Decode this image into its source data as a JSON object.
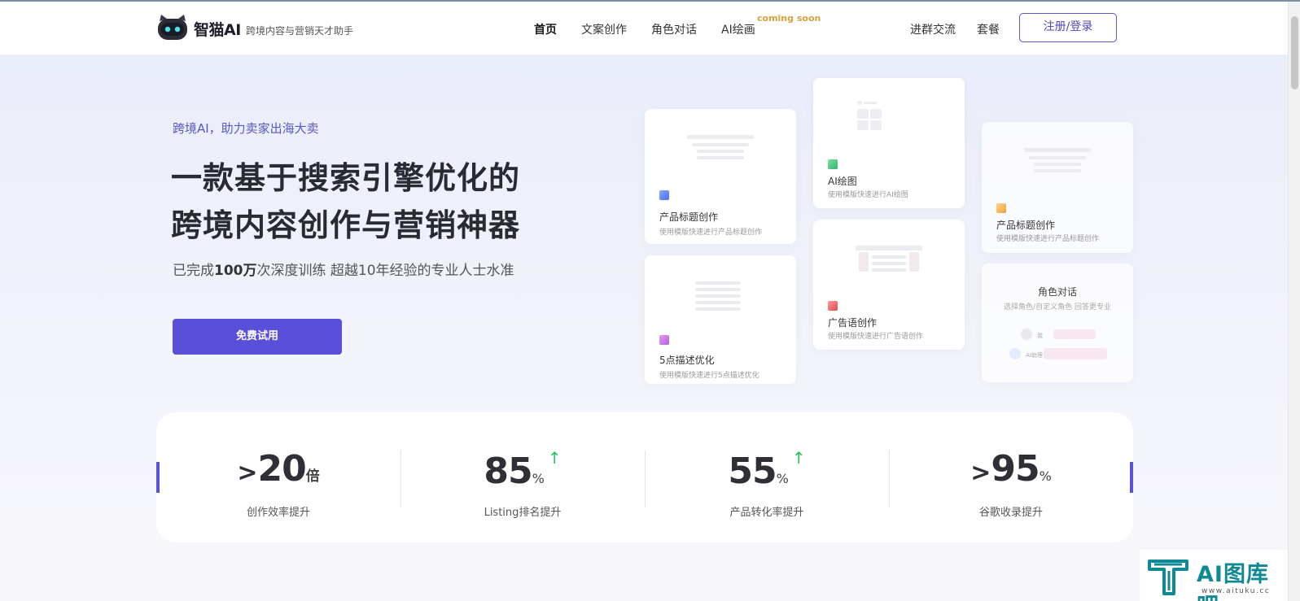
{
  "nav": {
    "brand": "智猫AI",
    "slogan": "跨境内容与营销天才助手",
    "items": [
      {
        "label": "首页"
      },
      {
        "label": "文案创作"
      },
      {
        "label": "角色对话"
      },
      {
        "label": "AI绘画"
      }
    ],
    "badge": "coming soon",
    "right_items": [
      {
        "label": "进群交流"
      },
      {
        "label": "套餐"
      }
    ],
    "login_label": "注册/登录"
  },
  "hero": {
    "kicker": "跨境AI，助力卖家出海大卖",
    "headline_line1": "一款基于搜索引擎优化的",
    "headline_line2": "跨境内容创作与营销神器",
    "desc_prefix": "已完成",
    "desc_bold": "100万",
    "desc_suffix": "次深度训练 超越10年经验的专业人士水准",
    "cta_label": "免费试用"
  },
  "cards": {
    "product_title": {
      "title": "产品标题创作",
      "subtitle": "使用模版快速进行产品标题创作"
    },
    "five_point": {
      "title": "5点描述优化",
      "subtitle": "使用模版快速进行5点描述优化"
    },
    "ai_draw": {
      "title": "AI绘图",
      "subtitle": "使用模版快速进行AI绘图"
    },
    "ad_copy": {
      "title": "广告语创作",
      "subtitle": "使用模版快速进行广告语创作"
    },
    "product_title_2": {
      "title": "产品标题创作",
      "subtitle": "使用模版快速进行产品标题创作"
    },
    "role_chat": {
      "title": "角色对话",
      "subtitle": "选择角色/自定义角色 回答更专业",
      "me_label": "我",
      "ai_label": "AI助理"
    }
  },
  "stats": [
    {
      "prefix": ">",
      "value": "20",
      "unit": "倍",
      "arrow": "",
      "label": "创作效率提升"
    },
    {
      "prefix": "",
      "value": "85",
      "unit": "%",
      "arrow": "↑",
      "label": "Listing排名提升"
    },
    {
      "prefix": "",
      "value": "55",
      "unit": "%",
      "arrow": "↑",
      "label": "产品转化率提升"
    },
    {
      "prefix": ">",
      "value": "95",
      "unit": "%",
      "arrow": "",
      "label": "谷歌收录提升"
    }
  ],
  "watermark": {
    "text": "AI图库吧",
    "url": "www.aituku.cc"
  },
  "colors": {
    "accent": "#5a4fd8",
    "arrow_green": "#2fbf63",
    "badge_orange": "#d8a23a",
    "watermark_teal": "#0f8a95"
  }
}
